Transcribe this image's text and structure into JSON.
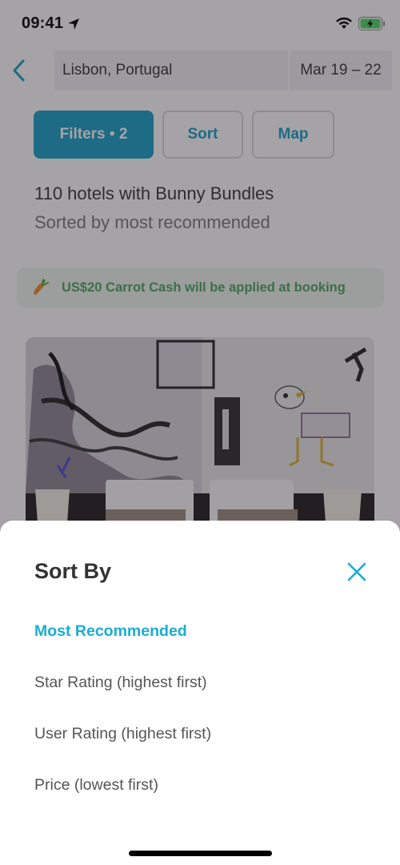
{
  "status_bar": {
    "time": "09:41",
    "icons": [
      "location-arrow-icon",
      "wifi-icon",
      "battery-charging-icon"
    ],
    "battery_color": "#4cd964"
  },
  "header": {
    "back_icon": "chevron-left-icon",
    "location": "Lisbon, Portugal",
    "dates": "Mar 19 – 22"
  },
  "toolbar": {
    "filters_label": "Filters • 2",
    "sort_label": "Sort",
    "map_label": "Map"
  },
  "results": {
    "title": "110 hotels with Bunny Bundles",
    "subtitle": "Sorted by most recommended"
  },
  "promo": {
    "icon": "carrot-icon",
    "text": "US$20 Carrot Cash will be applied at booking"
  },
  "hotel_card": {
    "image": "hotel-room-photo"
  },
  "sort_sheet": {
    "title": "Sort By",
    "close_icon": "close-icon",
    "selected_index": 0,
    "options": [
      {
        "label": "Most Recommended",
        "selected": true
      },
      {
        "label": "Star Rating (highest first)",
        "selected": false
      },
      {
        "label": "User Rating (highest first)",
        "selected": false
      },
      {
        "label": "Price (lowest first)",
        "selected": false
      }
    ]
  },
  "colors": {
    "accent": "#169fc5",
    "accent_light": "#1aaed0",
    "promo_green": "#4fa45f",
    "promo_bg": "#eef6ee",
    "text_dark": "#333333",
    "text_muted": "#777777"
  }
}
